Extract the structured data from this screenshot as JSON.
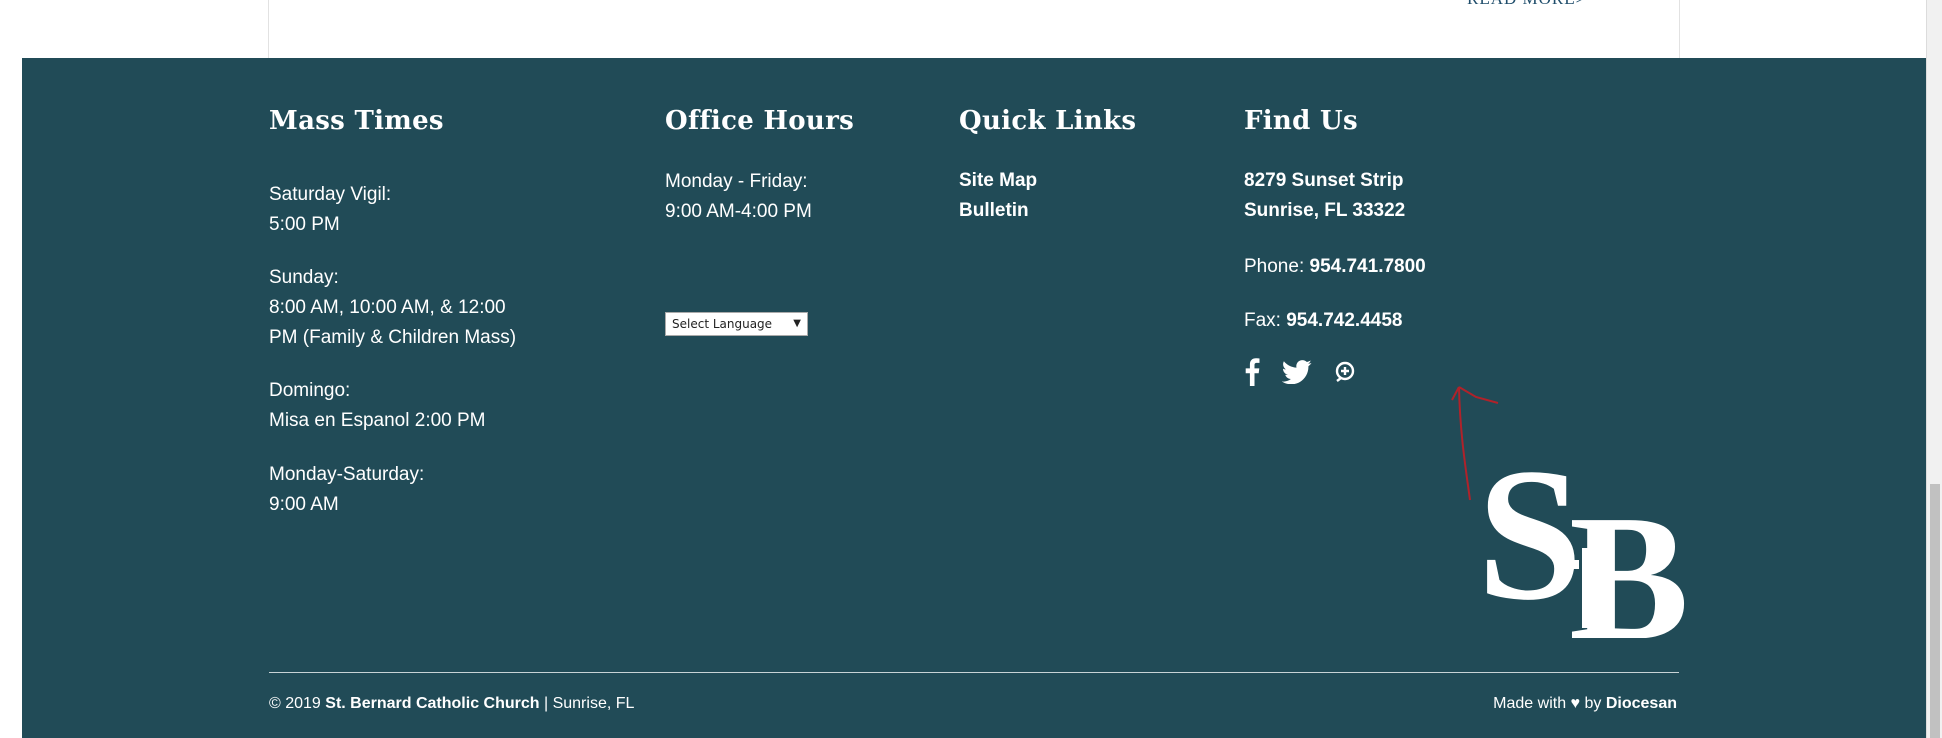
{
  "content": {
    "read_more": "READ MORE>"
  },
  "mass_times": {
    "title": "Mass Times",
    "saturday_label": "Saturday Vigil:",
    "saturday_time": "5:00 PM",
    "sunday_label": "Sunday:",
    "sunday_line1": "8:00 AM, 10:00 AM, & 12:00",
    "sunday_line2": "PM (Family & Children Mass)",
    "domingo_label": "Domingo:",
    "domingo_time": "Misa en Espanol 2:00 PM",
    "weekday_label": "Monday-Saturday:",
    "weekday_time": "9:00 AM"
  },
  "office_hours": {
    "title": "Office Hours",
    "days": "Monday - Friday:",
    "hours": "9:00 AM-4:00 PM",
    "language_select": "Select Language"
  },
  "quick_links": {
    "title": "Quick Links",
    "items": [
      "Site Map",
      "Bulletin"
    ]
  },
  "find_us": {
    "title": "Find Us",
    "address1": "8279 Sunset Strip",
    "address2": "Sunrise, FL 33322",
    "phone_label": "Phone:",
    "phone": "954.741.7800",
    "fax_label": "Fax:",
    "fax": "954.742.4458",
    "social_icons": [
      "facebook-icon",
      "twitter-icon",
      "location-icon"
    ]
  },
  "logo": {
    "text_s": "S",
    "text_b": "B"
  },
  "bottom": {
    "copyright": "© 2019",
    "church": "St. Bernard Catholic Church",
    "location": "| Sunrise, FL",
    "made_with": "Made with",
    "heart": "♥",
    "by": "by",
    "maker": "Diocesan"
  },
  "colors": {
    "footer_bg": "#214b57",
    "text": "#ffffff",
    "annotation": "#b0222a"
  }
}
